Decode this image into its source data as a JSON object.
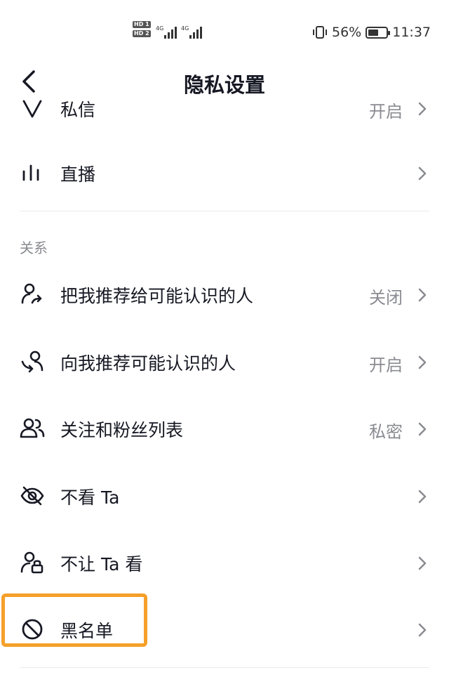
{
  "status_bar": {
    "hd1": "HD 1",
    "hd2": "HD 2",
    "net1": "4G",
    "net2": "4G",
    "battery_percent": "56%",
    "battery_level": 0.56,
    "time": "11:37"
  },
  "header": {
    "title": "隐私设置"
  },
  "rows_top": [
    {
      "label": "私信",
      "value": "开启",
      "icon": "message-icon"
    },
    {
      "label": "直播",
      "value": "",
      "icon": "live-bars-icon"
    }
  ],
  "section_relations": {
    "title": "关系",
    "items": [
      {
        "label": "把我推荐给可能认识的人",
        "value": "关闭",
        "icon": "user-share-icon"
      },
      {
        "label": "向我推荐可能认识的人",
        "value": "开启",
        "icon": "user-recommend-icon"
      },
      {
        "label": "关注和粉丝列表",
        "value": "私密",
        "icon": "users-icon"
      },
      {
        "label": "不看 Ta",
        "value": "",
        "icon": "eye-off-icon"
      },
      {
        "label": "不让 Ta 看",
        "value": "",
        "icon": "user-lock-icon"
      },
      {
        "label": "黑名单",
        "value": "",
        "icon": "block-icon"
      }
    ]
  },
  "colors": {
    "text_primary": "#161823",
    "text_secondary": "#8a8b91",
    "divider": "#ebebed",
    "highlight": "#f5a02a"
  }
}
